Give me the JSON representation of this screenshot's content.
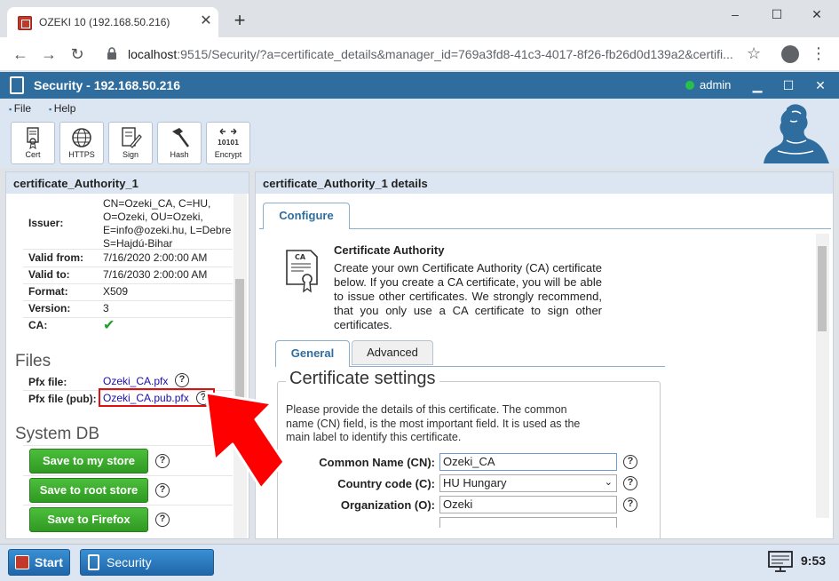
{
  "browser": {
    "tab_title": "OZEKI 10 (192.168.50.216)",
    "tab_close": "✕",
    "new_tab": "+",
    "url_host": "localhost",
    "url_rest": ":9515/Security/?a=certificate_details&manager_id=769a3fd8-41c3-4017-8f26-fb26d0d139a2&certifi...",
    "win_min": "–",
    "win_max": "☐",
    "win_close": "✕",
    "nav_back": "←",
    "nav_forward": "→",
    "nav_reload": "↻",
    "star": "☆",
    "menu": "⋮"
  },
  "app": {
    "title": "Security - 192.168.50.216",
    "user": "admin",
    "btn_min": "▁",
    "btn_max": "☐",
    "btn_close": "✕",
    "menu": [
      "File",
      "Help"
    ],
    "ribbon": [
      "Cert",
      "HTTPS",
      "Sign",
      "Hash",
      "Encrypt"
    ]
  },
  "left": {
    "header": "certificate_Authority_1",
    "issuer_label": "Issuer:",
    "issuer_lines": [
      "CN=Ozeki_CA, C=HU,",
      "O=Ozeki, OU=Ozeki,",
      "E=info@ozeki.hu, L=Debre",
      "S=Hajdú-Bihar"
    ],
    "props": [
      {
        "label": "Valid from:",
        "value": "7/16/2020 2:00:00 AM"
      },
      {
        "label": "Valid to:",
        "value": "7/16/2030 2:00:00 AM"
      },
      {
        "label": "Format:",
        "value": "X509"
      },
      {
        "label": "Version:",
        "value": "3"
      },
      {
        "label": "CA:",
        "value": "✔"
      }
    ],
    "files_title": "Files",
    "pfx_label": "Pfx file:",
    "pfx_value": "Ozeki_CA.pfx",
    "pfxpub_label": "Pfx file (pub):",
    "pfxpub_value": "Ozeki_CA.pub.pfx",
    "systemdb_title": "System DB",
    "buttons": [
      "Save to my store",
      "Save to root store",
      "Save to Firefox"
    ],
    "help": "?"
  },
  "right": {
    "header": "certificate_Authority_1 details",
    "tab_configure": "Configure",
    "ca_title": "Certificate Authority",
    "ca_desc": "Create your own Certificate Authority (CA) certificate below. If you create a CA certificate, you will be able to issue other certificates. We strongly recommend, that you only use a CA certificate to sign other certificates.",
    "ca_icon_text": "CA",
    "tab_general": "General",
    "tab_advanced": "Advanced",
    "legend": "Certificate settings",
    "cs_desc": "Please provide the details of this certificate. The common name (CN) field, is the most important field. It is used as the main label to identify this certificate.",
    "fields": [
      {
        "label": "Common Name (CN):",
        "value": "Ozeki_CA"
      },
      {
        "label": "Country code (C):",
        "value": "HU Hungary"
      },
      {
        "label": "Organization (O):",
        "value": "Ozeki"
      }
    ],
    "select_arrow": "⌄"
  },
  "taskbar": {
    "start": "Start",
    "task": "Security",
    "clock": "9:53"
  }
}
